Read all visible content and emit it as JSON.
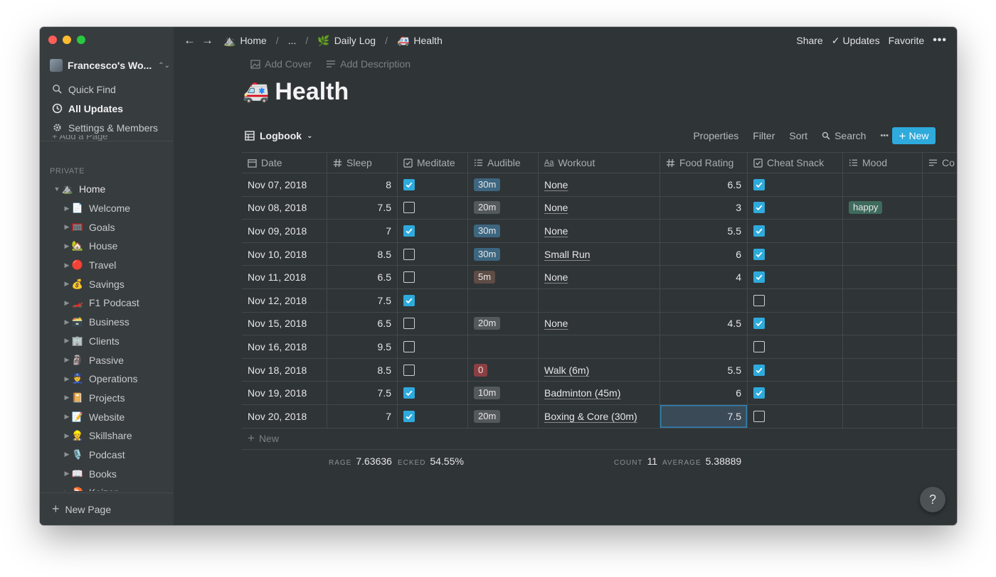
{
  "workspace": {
    "name": "Francesco's Wo..."
  },
  "sidebar": {
    "nav": [
      {
        "label": "Quick Find",
        "icon": "search-icon"
      },
      {
        "label": "All Updates",
        "icon": "clock-icon",
        "active": true
      },
      {
        "label": "Settings & Members",
        "icon": "gear-icon"
      }
    ],
    "cutoff_label": "Add a Page",
    "section_label": "PRIVATE",
    "tree": [
      {
        "label": "Home",
        "emoji": "⛰️",
        "root": true,
        "expanded": true
      },
      {
        "label": "Welcome",
        "emoji": "📄"
      },
      {
        "label": "Goals",
        "emoji": "🥅"
      },
      {
        "label": "House",
        "emoji": "🏡"
      },
      {
        "label": "Travel",
        "emoji": "🔴"
      },
      {
        "label": "Savings",
        "emoji": "💰"
      },
      {
        "label": "F1 Podcast",
        "emoji": "🏎️"
      },
      {
        "label": "Business",
        "emoji": "🗃️"
      },
      {
        "label": "Clients",
        "emoji": "🏢"
      },
      {
        "label": "Passive",
        "emoji": "🗿"
      },
      {
        "label": "Operations",
        "emoji": "👮"
      },
      {
        "label": "Projects",
        "emoji": "📔"
      },
      {
        "label": "Website",
        "emoji": "📝"
      },
      {
        "label": "Skillshare",
        "emoji": "👷"
      },
      {
        "label": "Podcast",
        "emoji": "🎙️"
      },
      {
        "label": "Books",
        "emoji": "📖"
      },
      {
        "label": "Kaizen",
        "emoji": "🍣"
      }
    ],
    "new_page_label": "New Page"
  },
  "topbar": {
    "breadcrumbs": [
      {
        "label": "Home",
        "emoji": "⛰️"
      },
      {
        "label": "...",
        "emoji": ""
      },
      {
        "label": "Daily Log",
        "emoji": "🌿"
      },
      {
        "label": "Health",
        "emoji": "🚑"
      }
    ],
    "share": "Share",
    "updates": "Updates",
    "favorite": "Favorite",
    "more": "•••"
  },
  "page": {
    "add_cover": "Add Cover",
    "add_description": "Add Description",
    "emoji": "🚑",
    "title": "Health"
  },
  "database": {
    "view_name": "Logbook",
    "actions": {
      "properties": "Properties",
      "filter": "Filter",
      "sort": "Sort",
      "search": "Search",
      "more": "•••",
      "new": "New"
    },
    "columns": [
      {
        "label": "Date",
        "icon": "calendar-icon"
      },
      {
        "label": "Sleep",
        "icon": "hash-icon"
      },
      {
        "label": "Meditate",
        "icon": "checkbox-icon"
      },
      {
        "label": "Audible",
        "icon": "list-icon"
      },
      {
        "label": "Workout",
        "icon": "text-icon"
      },
      {
        "label": "Food Rating",
        "icon": "hash-icon"
      },
      {
        "label": "Cheat Snack",
        "icon": "checkbox-icon"
      },
      {
        "label": "Mood",
        "icon": "list-icon"
      },
      {
        "label": "Co",
        "icon": "lines-icon"
      }
    ],
    "rows": [
      {
        "date": "Nov 07, 2018",
        "sleep": "8",
        "meditate": true,
        "audible": "30m",
        "audible_color": "#3d6680",
        "workout": "None",
        "food": "6.5",
        "cheat": true,
        "mood": ""
      },
      {
        "date": "Nov 08, 2018",
        "sleep": "7.5",
        "meditate": false,
        "audible": "20m",
        "audible_color": "#54595c",
        "workout": "None",
        "food": "3",
        "cheat": true,
        "mood": "happy"
      },
      {
        "date": "Nov 09, 2018",
        "sleep": "7",
        "meditate": true,
        "audible": "30m",
        "audible_color": "#3d6680",
        "workout": "None",
        "food": "5.5",
        "cheat": true,
        "mood": ""
      },
      {
        "date": "Nov 10, 2018",
        "sleep": "8.5",
        "meditate": false,
        "audible": "30m",
        "audible_color": "#3d6680",
        "workout": "Small Run",
        "food": "6",
        "cheat": true,
        "mood": ""
      },
      {
        "date": "Nov 11, 2018",
        "sleep": "6.5",
        "meditate": false,
        "audible": "5m",
        "audible_color": "#5e4c46",
        "workout": "None",
        "food": "4",
        "cheat": true,
        "mood": ""
      },
      {
        "date": "Nov 12, 2018",
        "sleep": "7.5",
        "meditate": true,
        "audible": "",
        "audible_color": "",
        "workout": "",
        "food": "",
        "cheat": false,
        "mood": ""
      },
      {
        "date": "Nov 15, 2018",
        "sleep": "6.5",
        "meditate": false,
        "audible": "20m",
        "audible_color": "#54595c",
        "workout": "None",
        "food": "4.5",
        "cheat": true,
        "mood": ""
      },
      {
        "date": "Nov 16, 2018",
        "sleep": "9.5",
        "meditate": false,
        "audible": "",
        "audible_color": "",
        "workout": "",
        "food": "",
        "cheat": false,
        "mood": ""
      },
      {
        "date": "Nov 18, 2018",
        "sleep": "8.5",
        "meditate": false,
        "audible": "0",
        "audible_color": "#8c3f42",
        "workout": "Walk (6m)",
        "food": "5.5",
        "cheat": true,
        "mood": ""
      },
      {
        "date": "Nov 19, 2018",
        "sleep": "7.5",
        "meditate": true,
        "audible": "10m",
        "audible_color": "#54595c",
        "workout": "Badminton (45m)",
        "food": "6",
        "cheat": true,
        "mood": ""
      },
      {
        "date": "Nov 20, 2018",
        "sleep": "7",
        "meditate": true,
        "audible": "20m",
        "audible_color": "#54595c",
        "workout": "Boxing & Core (30m)",
        "food": "7.5",
        "cheat": false,
        "mood": "",
        "selected": true
      }
    ],
    "mood_color": "#3e6b5c",
    "add_row_label": "New",
    "calculations": {
      "sleep_label": "RAGE",
      "sleep_value": "7.63636",
      "meditate_label": "ECKED",
      "meditate_value": "54.55%",
      "food_count_label": "COUNT",
      "food_count_value": "11",
      "food_avg_label": "AVERAGE",
      "food_avg_value": "5.38889"
    }
  },
  "help_label": "?"
}
